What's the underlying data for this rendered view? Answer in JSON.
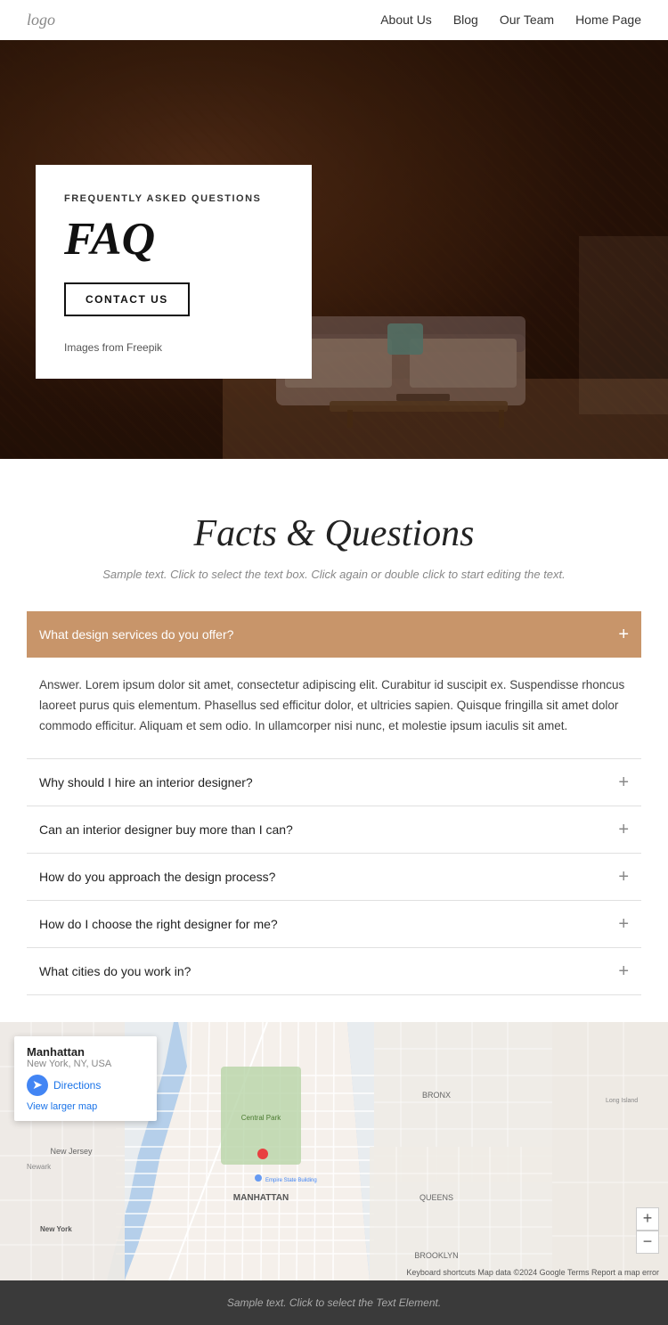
{
  "nav": {
    "logo": "logo",
    "links": [
      {
        "label": "About Us",
        "href": "#"
      },
      {
        "label": "Blog",
        "href": "#"
      },
      {
        "label": "Our Team",
        "href": "#"
      },
      {
        "label": "Home Page",
        "href": "#"
      }
    ]
  },
  "hero": {
    "eyebrow": "FREQUENTLY ASKED QUESTIONS",
    "title": "FAQ",
    "contact_btn": "CONTACT US",
    "images_from_text": "Images from ",
    "images_from_link": "Freepik"
  },
  "faq_section": {
    "title": "Facts & Questions",
    "subtitle": "Sample text. Click to select the text box. Click again or double click to start editing the text.",
    "questions": [
      {
        "question": "What design services do you offer?",
        "answer": "Answer. Lorem ipsum dolor sit amet, consectetur adipiscing elit. Curabitur id suscipit ex. Suspendisse rhoncus laoreet purus quis elementum. Phasellus sed efficitur dolor, et ultricies sapien. Quisque fringilla sit amet dolor commodo efficitur. Aliquam et sem odio. In ullamcorper nisi nunc, et molestie ipsum iaculis sit amet.",
        "open": true
      },
      {
        "question": "Why should I hire an interior designer?",
        "answer": "",
        "open": false
      },
      {
        "question": "Can an interior designer buy more than I can?",
        "answer": "",
        "open": false
      },
      {
        "question": "How do you approach the design process?",
        "answer": "",
        "open": false
      },
      {
        "question": "How do I choose the right designer for me?",
        "answer": "",
        "open": false
      },
      {
        "question": "What cities do you work in?",
        "answer": "",
        "open": false
      }
    ]
  },
  "map": {
    "place_name": "Manhattan",
    "place_sub": "New York, NY, USA",
    "directions_label": "Directions",
    "larger_map": "View larger map",
    "zoom_in": "+",
    "zoom_out": "−",
    "attribution": "Keyboard shortcuts  Map data ©2024 Google  Terms  Report a map error"
  },
  "footer": {
    "text": "Sample text. Click to select the Text Element."
  }
}
